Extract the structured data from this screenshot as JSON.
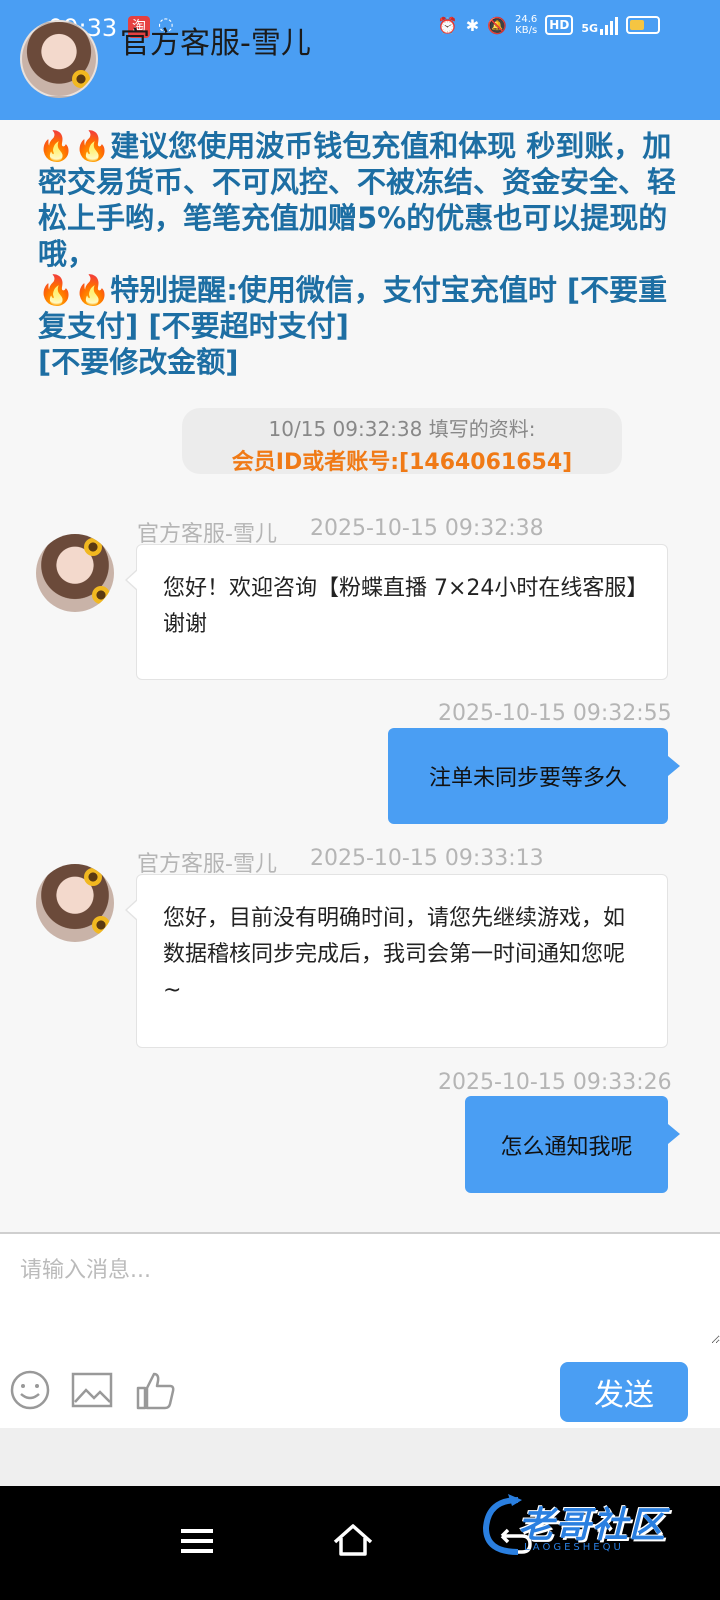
{
  "status_bar": {
    "time": "09:33",
    "net_speed_value": "24.6",
    "net_speed_unit": "KB/s",
    "hd": "HD",
    "network": "5G",
    "notif_icon": "taobao-icon"
  },
  "header": {
    "title": "官方客服-雪儿"
  },
  "notice": {
    "line1": "🔥🔥建议您使用波币钱包充值和体现 秒到账，加密交易货币、不可风控、不被冻结、资金安全、轻松上手哟，笔笔充值加赠5%的优惠也可以提现的哦，",
    "line2": "🔥🔥特别提醒:使用微信，支付宝充值时 [不要重复支付] [不要超时支付]",
    "line3": "[不要修改金额]"
  },
  "system_info": {
    "line1": "10/15 09:32:38 填写的资料:",
    "line2": "会员ID或者账号:[1464061654]"
  },
  "messages": [
    {
      "sender": "官方客服-雪儿",
      "time": "2025-10-15 09:32:38",
      "text": "您好！欢迎咨询【粉蝶直播 7×24小时在线客服】谢谢"
    },
    {
      "time": "2025-10-15 09:32:55",
      "text": "注单未同步要等多久"
    },
    {
      "sender": "官方客服-雪儿",
      "time": "2025-10-15 09:33:13",
      "text": "您好，目前没有明确时间，请您先继续游戏，如数据稽核同步完成后，我司会第一时间通知您呢~"
    },
    {
      "time": "2025-10-15 09:33:26",
      "text": "怎么通知我呢"
    }
  ],
  "composer": {
    "placeholder": "请输入消息...",
    "send_label": "发送",
    "tools": [
      "emoji-icon",
      "image-icon",
      "thumbs-up-icon"
    ]
  },
  "watermark": {
    "text": "老哥社区",
    "sub": "LAOGESHEQU"
  },
  "colors": {
    "primary": "#4a9ef3",
    "notice_text": "#1d6ea3",
    "highlight_orange": "#f07a16"
  }
}
